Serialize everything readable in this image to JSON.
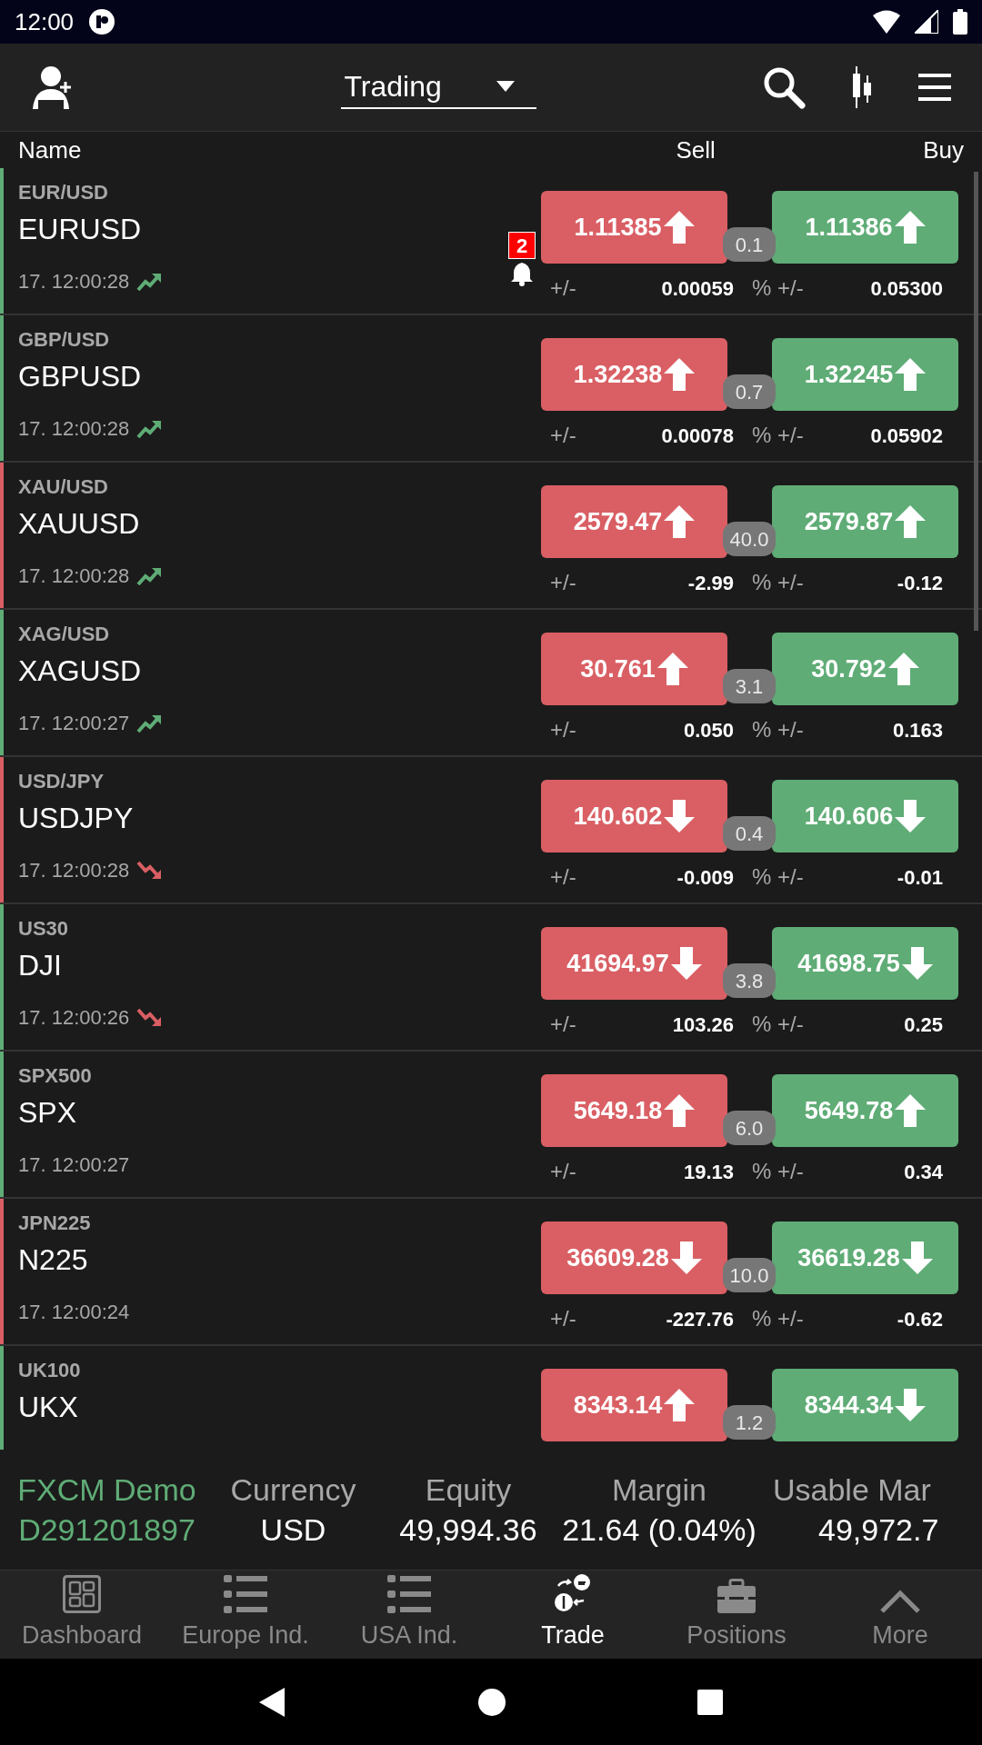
{
  "status_bar": {
    "time": "12:00"
  },
  "top_bar": {
    "dropdown": "Trading"
  },
  "columns": {
    "name": "Name",
    "sell": "Sell",
    "buy": "Buy"
  },
  "rows": [
    {
      "group": "EUR/USD",
      "symbol": "EURUSD",
      "time": "17. 12:00:28",
      "trend_rising": true,
      "color": "#5fac76",
      "alert_count": "2",
      "sell": "1.11385",
      "sell_rising": true,
      "spread": "0.1",
      "buy": "1.11386",
      "buy_rising": true,
      "change_label": "+/-",
      "change": "0.00059",
      "pct_label": "% +/-",
      "pct": "0.05300"
    },
    {
      "group": "GBP/USD",
      "symbol": "GBPUSD",
      "time": "17. 12:00:28",
      "trend_rising": true,
      "color": "#5fac76",
      "sell": "1.32238",
      "sell_rising": true,
      "spread": "0.7",
      "buy": "1.32245",
      "buy_rising": true,
      "change_label": "+/-",
      "change": "0.00078",
      "pct_label": "% +/-",
      "pct": "0.05902"
    },
    {
      "group": "XAU/USD",
      "symbol": "XAUUSD",
      "time": "17. 12:00:28",
      "trend_rising": true,
      "color": "#d95f64",
      "sell": "2579.47",
      "sell_rising": true,
      "spread": "40.0",
      "buy": "2579.87",
      "buy_rising": true,
      "change_label": "+/-",
      "change": "-2.99",
      "pct_label": "% +/-",
      "pct": "-0.12"
    },
    {
      "group": "XAG/USD",
      "symbol": "XAGUSD",
      "time": "17. 12:00:27",
      "trend_rising": true,
      "color": "#5fac76",
      "sell": "30.761",
      "sell_rising": true,
      "spread": "3.1",
      "buy": "30.792",
      "buy_rising": true,
      "change_label": "+/-",
      "change": "0.050",
      "pct_label": "% +/-",
      "pct": "0.163"
    },
    {
      "group": "USD/JPY",
      "symbol": "USDJPY",
      "time": "17. 12:00:28",
      "trend_rising": false,
      "color": "#d95f64",
      "sell": "140.602",
      "sell_rising": false,
      "spread": "0.4",
      "buy": "140.606",
      "buy_rising": false,
      "change_label": "+/-",
      "change": "-0.009",
      "pct_label": "% +/-",
      "pct": "-0.01"
    },
    {
      "group": "US30",
      "symbol": "DJI",
      "time": "17. 12:00:26",
      "trend_rising": false,
      "color": "#5fac76",
      "sell": "41694.97",
      "sell_rising": false,
      "spread": "3.8",
      "buy": "41698.75",
      "buy_rising": false,
      "change_label": "+/-",
      "change": "103.26",
      "pct_label": "% +/-",
      "pct": "0.25"
    },
    {
      "group": "SPX500",
      "symbol": "SPX",
      "time": "17. 12:00:27",
      "color": "#5fac76",
      "sell": "5649.18",
      "sell_rising": true,
      "spread": "6.0",
      "buy": "5649.78",
      "buy_rising": true,
      "change_label": "+/-",
      "change": "19.13",
      "pct_label": "% +/-",
      "pct": "0.34"
    },
    {
      "group": "JPN225",
      "symbol": "N225",
      "time": "17. 12:00:24",
      "color": "#d95f64",
      "sell": "36609.28",
      "sell_rising": false,
      "spread": "10.0",
      "buy": "36619.28",
      "buy_rising": false,
      "change_label": "+/-",
      "change": "-227.76",
      "pct_label": "% +/-",
      "pct": "-0.62"
    },
    {
      "group": "UK100",
      "symbol": "UKX",
      "color": "#5fac76",
      "sell": "8343.14",
      "sell_rising": true,
      "spread": "1.2",
      "buy": "8344.34",
      "buy_rising": false
    }
  ],
  "account": [
    {
      "label": "FXCM Demo",
      "value": "D291201897",
      "kind": "account"
    },
    {
      "label": "Currency",
      "value": "USD"
    },
    {
      "label": "Equity",
      "value": "49,994.36"
    },
    {
      "label": "Margin",
      "value": "21.64 (0.04%)"
    },
    {
      "label": "Usable Mar",
      "value": "49,972.7"
    }
  ],
  "nav": [
    {
      "label": "Dashboard",
      "selected": false
    },
    {
      "label": "Europe Ind.",
      "selected": false
    },
    {
      "label": "USA Ind.",
      "selected": false
    },
    {
      "label": "Trade",
      "selected": true
    },
    {
      "label": "Positions",
      "selected": false
    },
    {
      "label": "More",
      "selected": false
    }
  ]
}
